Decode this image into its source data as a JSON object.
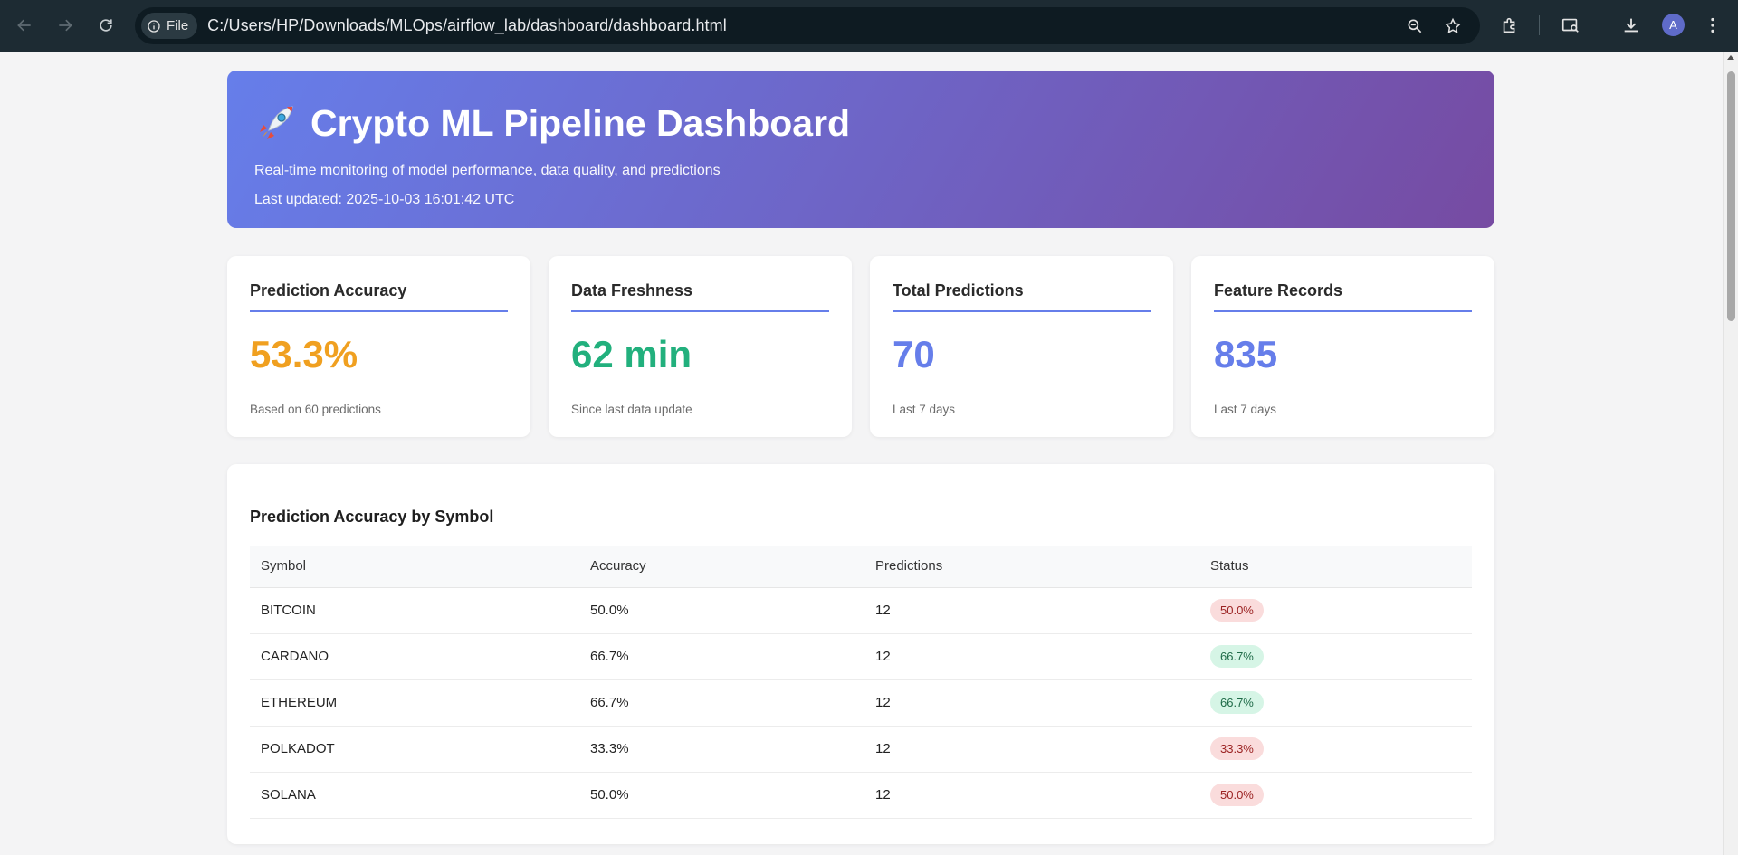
{
  "browser": {
    "file_label": "File",
    "url": "C:/Users/HP/Downloads/MLOps/airflow_lab/dashboard/dashboard.html",
    "profile_initial": "A"
  },
  "header": {
    "title": "Crypto ML Pipeline Dashboard",
    "icon": "rocket-icon",
    "subtitle": "Real-time monitoring of model performance, data quality, and predictions",
    "last_updated": "Last updated: 2025-10-03 16:01:42 UTC"
  },
  "metrics": [
    {
      "title": "Prediction Accuracy",
      "value": "53.3%",
      "note": "Based on 60 predictions",
      "color": "#f0a020"
    },
    {
      "title": "Data Freshness",
      "value": "62 min",
      "note": "Since last data update",
      "color": "#22b07d"
    },
    {
      "title": "Total Predictions",
      "value": "70",
      "note": "Last 7 days",
      "color": "#667eea"
    },
    {
      "title": "Feature Records",
      "value": "835",
      "note": "Last 7 days",
      "color": "#667eea"
    }
  ],
  "accuracy_table": {
    "title": "Prediction Accuracy by Symbol",
    "headers": [
      "Symbol",
      "Accuracy",
      "Predictions",
      "Status"
    ],
    "rows": [
      {
        "symbol": "BITCOIN",
        "accuracy": "50.0%",
        "predictions": "12",
        "status": "50.0%",
        "status_level": "bad"
      },
      {
        "symbol": "CARDANO",
        "accuracy": "66.7%",
        "predictions": "12",
        "status": "66.7%",
        "status_level": "good"
      },
      {
        "symbol": "ETHEREUM",
        "accuracy": "66.7%",
        "predictions": "12",
        "status": "66.7%",
        "status_level": "good"
      },
      {
        "symbol": "POLKADOT",
        "accuracy": "33.3%",
        "predictions": "12",
        "status": "33.3%",
        "status_level": "bad"
      },
      {
        "symbol": "SOLANA",
        "accuracy": "50.0%",
        "predictions": "12",
        "status": "50.0%",
        "status_level": "bad"
      }
    ]
  },
  "colors": {
    "badge_good_bg": "#d6f5e6",
    "badge_good_fg": "#1f6b48",
    "badge_bad_bg": "#fadcdc",
    "badge_bad_fg": "#9b2222"
  }
}
